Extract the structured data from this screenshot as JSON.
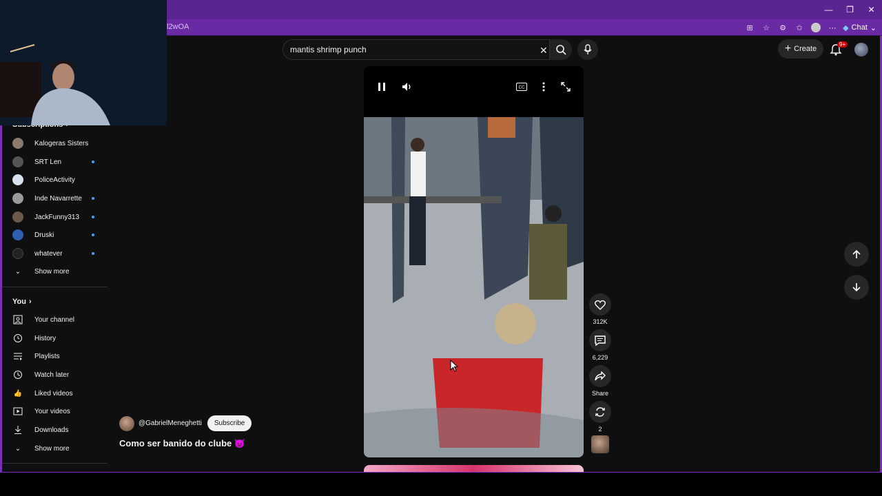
{
  "browser": {
    "url_fragment": "l2wOA",
    "chat_label": "Chat",
    "accent": "#5a2590"
  },
  "header": {
    "search_value": "mantis shrimp punch",
    "create_label": "Create",
    "notification_count": "9+"
  },
  "sidebar": {
    "subscriptions_heading": "Subscriptions",
    "subscriptions": [
      {
        "name": "Kalogeras Sisters",
        "live": false
      },
      {
        "name": "SRT Len",
        "live": true
      },
      {
        "name": "PoliceActivity",
        "live": false
      },
      {
        "name": "Inde Navarrette",
        "live": true
      },
      {
        "name": "JackFunny313",
        "live": true
      },
      {
        "name": "Druski",
        "live": true
      },
      {
        "name": "whatever",
        "live": true
      }
    ],
    "show_more_1": "Show more",
    "you_heading": "You",
    "you_items": [
      {
        "label": "Your channel",
        "icon": "person-box-icon"
      },
      {
        "label": "History",
        "icon": "history-icon"
      },
      {
        "label": "Playlists",
        "icon": "playlists-icon"
      },
      {
        "label": "Watch later",
        "icon": "clock-icon"
      },
      {
        "label": "Liked videos",
        "icon": "thumbs-up-icon"
      },
      {
        "label": "Your videos",
        "icon": "video-icon"
      },
      {
        "label": "Downloads",
        "icon": "download-icon"
      }
    ],
    "show_more_2": "Show more"
  },
  "short": {
    "channel_handle": "@GabrielMeneghetti",
    "subscribe_label": "Subscribe",
    "title": "Como ser banido do clube 😈",
    "likes": "312K",
    "comments": "6,229",
    "share_label": "Share",
    "remix_count": "2"
  }
}
